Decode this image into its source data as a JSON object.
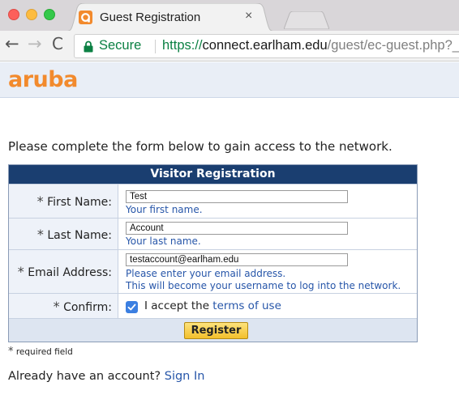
{
  "browser": {
    "tab_title": "Guest Registration",
    "tab_close": "×",
    "secure_label": "Secure",
    "url_scheme": "https://",
    "url_host": "connect.earlham.edu",
    "url_path": "/guest/ec-guest.php?_",
    "icons": {
      "back": "←",
      "forward": "→",
      "reload": "C"
    }
  },
  "brand": {
    "logo_text": "aruba",
    "logo_color": "#f28a2d"
  },
  "intro_text": "Please complete the form below to gain access to the network.",
  "form": {
    "title": "Visitor Registration",
    "required_marker": "*",
    "first_name": {
      "label": "First Name:",
      "value": "Test",
      "hint": "Your first name."
    },
    "last_name": {
      "label": "Last Name:",
      "value": "Account",
      "hint": "Your last name."
    },
    "email": {
      "label": "Email Address:",
      "value": "testaccount@earlham.edu",
      "hint_1": "Please enter your email address.",
      "hint_2": "This will become your username to log into the network."
    },
    "confirm": {
      "label": "Confirm:",
      "checked": true,
      "accept_prefix": "I accept the ",
      "terms_link": "terms of use"
    },
    "register_button": "Register"
  },
  "required_note": "required field",
  "signin": {
    "prefix": "Already have an account? ",
    "link": "Sign In"
  },
  "colors": {
    "panel_header": "#1a3e70",
    "link": "#2756a9",
    "secure_green": "#0b8043",
    "button_gold": "#f3c02c"
  }
}
